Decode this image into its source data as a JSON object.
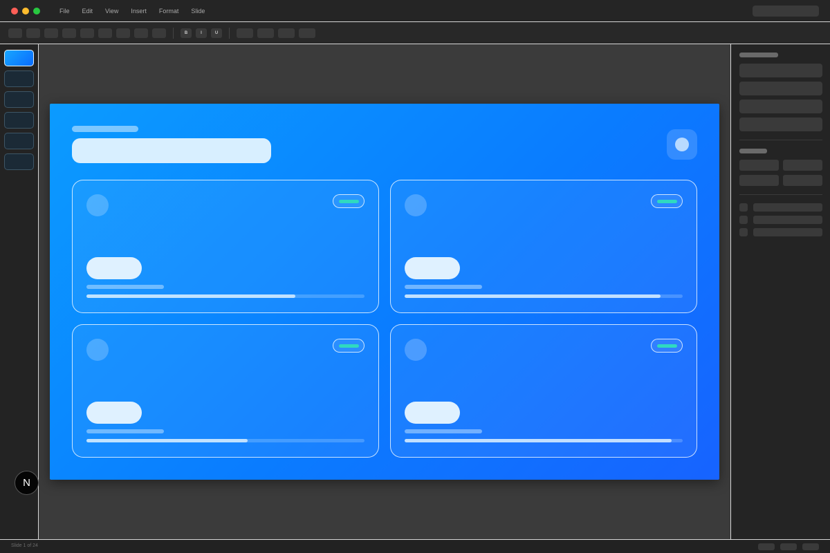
{
  "menu": {
    "items": [
      "File",
      "Edit",
      "View",
      "Insert",
      "Format",
      "Slide"
    ]
  },
  "toolbar": {
    "bold_label": "B",
    "italic_label": "I",
    "underline_label": "U"
  },
  "brand": {
    "badge_letter": "N"
  },
  "slides_panel": {
    "thumbnail_count": 6,
    "active_index": 0
  },
  "slide": {
    "cards": [
      {
        "progress": 0.75
      },
      {
        "progress": 0.92
      },
      {
        "progress": 0.58
      },
      {
        "progress": 0.96
      }
    ]
  },
  "status": {
    "slide_indicator": "Slide 1 of 24"
  },
  "colors": {
    "accent": "#0a7cff",
    "badge_teal": "#2fd9c0",
    "traffic_red": "#ff5f57",
    "traffic_yellow": "#febc2e",
    "traffic_green": "#28c840"
  }
}
